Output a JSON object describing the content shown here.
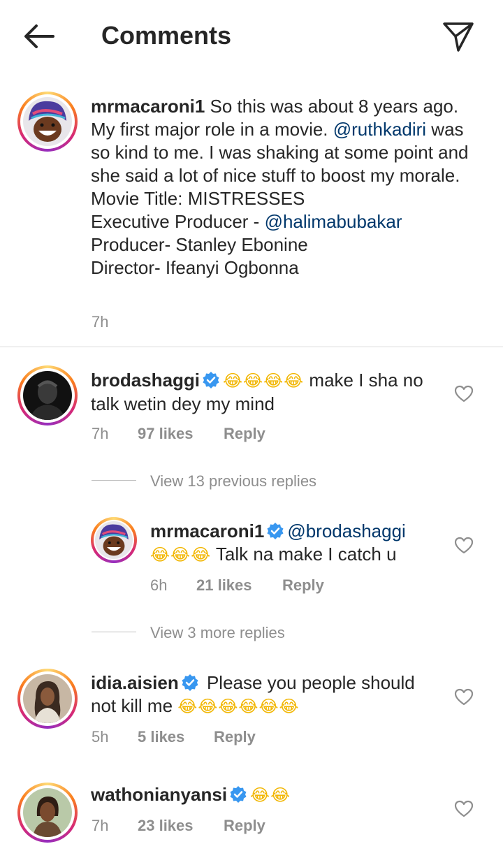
{
  "header": {
    "title": "Comments"
  },
  "caption": {
    "username": "mrmacaroni1",
    "text_1": " So this was about 8 years ago. My first major role in a movie. ",
    "mention_1": "@ruthkadiri",
    "text_2": " was so kind to me. I was shaking at some point and she said a lot of nice stuff to boost my morale.",
    "line_movie": "Movie Title: MISTRESSES",
    "line_exec": "Executive Producer - ",
    "mention_2": "@halimabubakar",
    "line_producer": "Producer- Stanley Ebonine",
    "line_director": "Director- Ifeanyi Ogbonna",
    "time": "7h"
  },
  "comments": [
    {
      "username": "brodashaggi",
      "verified": true,
      "emoji": "😂😂😂😂",
      "text": " make I sha no talk wetin dey my mind",
      "time": "7h",
      "likes": "97 likes",
      "reply": "Reply"
    },
    {
      "username": "idia.aisien",
      "verified": true,
      "text": " Please you people should not kill me ",
      "emoji": "😂😂😂😂😂😂",
      "time": "5h",
      "likes": "5 likes",
      "reply": "Reply"
    },
    {
      "username": "wathonianyansi",
      "verified": true,
      "emoji": "😂😂",
      "time": "7h",
      "likes": "23 likes",
      "reply": "Reply"
    }
  ],
  "replies": {
    "view_previous": "View 13 previous replies",
    "reply": {
      "username": "mrmacaroni1",
      "verified": true,
      "mention": "@brodashaggi",
      "emoji": "😂😂😂",
      "text": " Talk na make I catch u",
      "time": "6h",
      "likes": "21 likes",
      "reply": "Reply"
    },
    "view_more": "View 3 more replies"
  },
  "colors": {
    "text": "#262626",
    "secondary": "#8e8e8e",
    "mention": "#00376b",
    "verified": "#3897f0",
    "divider": "#dbdbdb"
  },
  "icons": {
    "back": "arrow-left-icon",
    "send": "paper-plane-icon",
    "like": "heart-outline-icon",
    "verified": "verified-badge-icon"
  }
}
